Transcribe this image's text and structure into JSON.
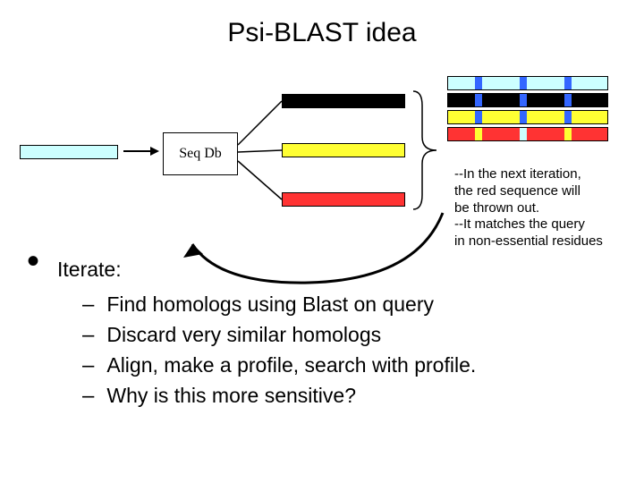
{
  "title": "Psi-BLAST idea",
  "seqdb_label": "Seq Db",
  "annotation": {
    "l1": "--In the next iteration,",
    "l2": "the red sequence will",
    "l3": "be thrown out.",
    "l4": "--It matches the query",
    "l5": " in non-essential residues"
  },
  "iterate_heading": "Iterate:",
  "bullets": {
    "b1": "Find homologs using Blast on query",
    "b2": "Discard very similar homologs",
    "b3": "Align, make a profile, search with profile.",
    "b4": "Why is this more sensitive?"
  },
  "colors": {
    "query": "#ccffff",
    "black": "#000000",
    "yellow": "#ffff33",
    "red": "#ff3333",
    "blue": "#3366ff"
  },
  "profile_rows": [
    {
      "base": "query",
      "marks": [
        [
          30,
          8,
          "blue"
        ],
        [
          80,
          8,
          "blue"
        ],
        [
          130,
          8,
          "blue"
        ]
      ]
    },
    {
      "base": "black",
      "marks": [
        [
          30,
          8,
          "blue"
        ],
        [
          80,
          8,
          "blue"
        ],
        [
          130,
          8,
          "blue"
        ]
      ]
    },
    {
      "base": "yellow",
      "marks": [
        [
          30,
          8,
          "blue"
        ],
        [
          80,
          8,
          "blue"
        ],
        [
          130,
          8,
          "blue"
        ]
      ]
    },
    {
      "base": "red",
      "marks": [
        [
          30,
          8,
          "yellow"
        ],
        [
          80,
          8,
          "query"
        ],
        [
          130,
          8,
          "yellow"
        ]
      ]
    }
  ]
}
